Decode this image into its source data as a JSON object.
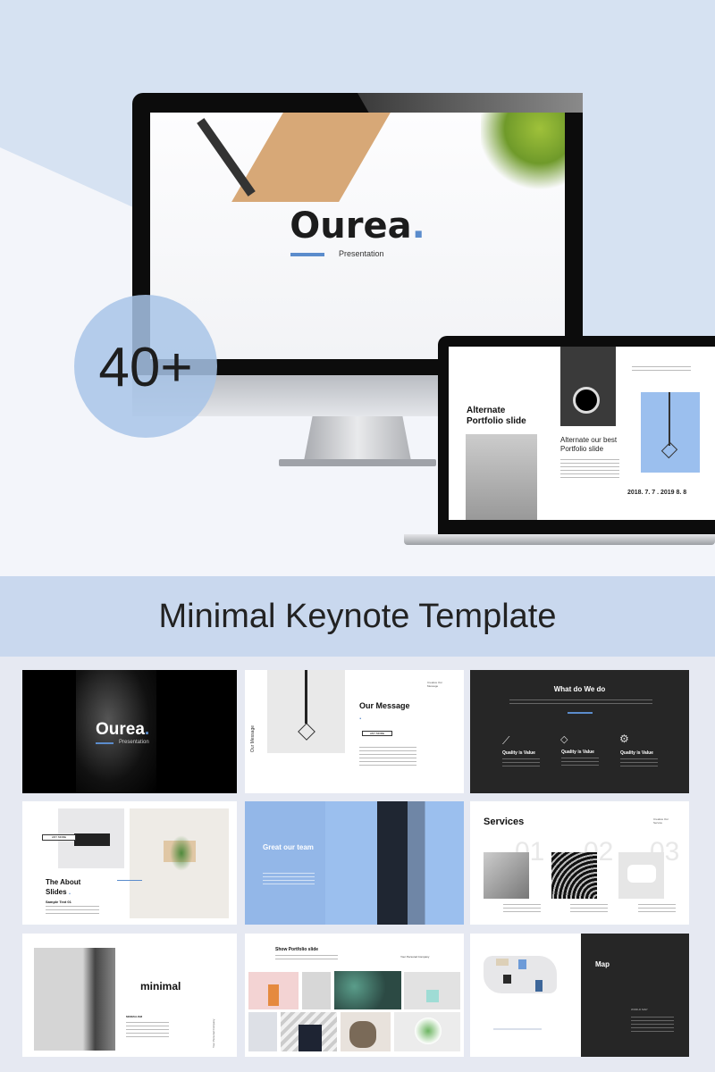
{
  "hero": {
    "desktop_slide": {
      "title": "Ourea",
      "title_dot": ".",
      "subtitle": "Presentation"
    },
    "badge": "40+",
    "laptop_slide": {
      "heading": "Alternate Portfolio slide",
      "subheading": "Alternate our best Portfolio slide",
      "dates": "2018. 7. 7 . 2019 8. 8"
    }
  },
  "banner": {
    "title": "Minimal Keynote Template"
  },
  "thumbnails": [
    {
      "title": "Ourea",
      "dot": ".",
      "subtitle": "Presentation"
    },
    {
      "title": "Our Message",
      "dot": ".",
      "button": "ANY MORE",
      "side_label": "Our Message",
      "corner": "Creative Our Message"
    },
    {
      "title": "What do We do",
      "features": [
        "Quality is Value",
        "Quality is Value",
        "Quality is Value"
      ]
    },
    {
      "title": "The About Slides",
      "dot": ".",
      "button": "ANY MORE",
      "sample": "Sample Text 01"
    },
    {
      "title": "Great our team"
    },
    {
      "title": "Services",
      "numbers": [
        "01",
        "02",
        "03"
      ],
      "corner": "Creative Our Service"
    },
    {
      "title": "minimal",
      "label": "MINIMALISM",
      "side_label": "Your Personal Company"
    },
    {
      "title": "Show Portfolio slide",
      "corner": "Your Personal Company"
    },
    {
      "title": "Map",
      "label": "WORLD MAP"
    }
  ],
  "colors": {
    "accent": "#5b8ccc",
    "background": "#d6e2f2",
    "banner": "#c9d8ee",
    "dark_slide": "#262626",
    "team_blue": "#9bbfee"
  }
}
